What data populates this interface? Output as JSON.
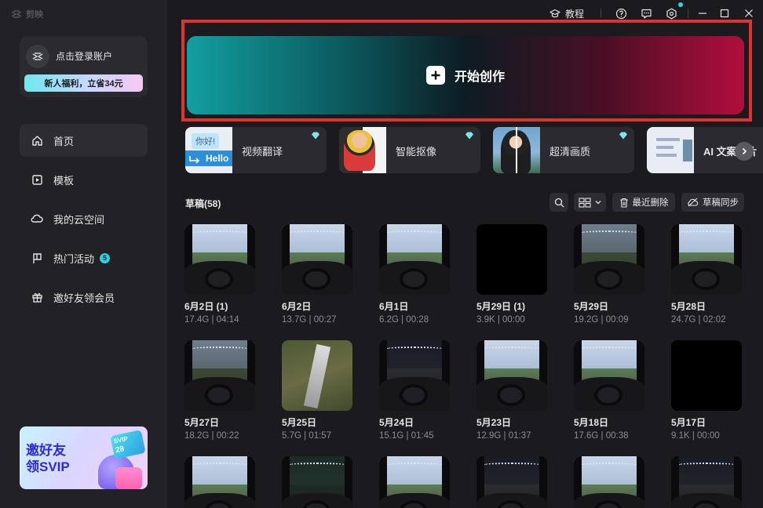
{
  "app": {
    "name": "剪映"
  },
  "titlebar": {
    "tutorial_label": "教程",
    "icons": [
      "help-icon",
      "feedback-icon",
      "settings-icon",
      "minimize-icon",
      "maximize-icon",
      "close-icon"
    ]
  },
  "account": {
    "login_label": "点击登录账户",
    "promo_label": "新人福利，立省34元"
  },
  "nav": [
    {
      "label": "首页",
      "icon": "home-icon",
      "active": true
    },
    {
      "label": "模板",
      "icon": "template-icon"
    },
    {
      "label": "我的云空间",
      "icon": "cloud-icon"
    },
    {
      "label": "热门活动",
      "icon": "flag-icon",
      "badge": "5"
    },
    {
      "label": "邀好友领会员",
      "icon": "gift-icon"
    }
  ],
  "svip_banner": {
    "text_line1": "邀好友",
    "text_line2": "领SVIP",
    "card_label": "SVIP",
    "card_value": "28"
  },
  "start": {
    "label": "开始创作"
  },
  "features": [
    {
      "label": "视频翻译",
      "thumb_text1": "你好!",
      "thumb_text2": "Hello"
    },
    {
      "label": "智能抠像"
    },
    {
      "label": "超清画质"
    },
    {
      "label": "AI 文案成片"
    }
  ],
  "drafts": {
    "title": "草稿(58)",
    "recent_delete_label": "最近删除",
    "sync_label": "草稿同步",
    "items": [
      {
        "name": "6月2日 (1)",
        "meta": "17.4G | 04:14",
        "style": "road"
      },
      {
        "name": "6月2日",
        "meta": "13.7G | 00:27",
        "style": "road"
      },
      {
        "name": "6月1日",
        "meta": "6.2G | 00:28",
        "style": "road"
      },
      {
        "name": "5月29日 (1)",
        "meta": "3.9K | 00:00",
        "style": "black"
      },
      {
        "name": "5月29日",
        "meta": "19.2G | 00:09",
        "style": "dim"
      },
      {
        "name": "5月28日",
        "meta": "24.7G | 02:02",
        "style": "road"
      },
      {
        "name": "5月27日",
        "meta": "18.2G | 00:22",
        "style": "dim"
      },
      {
        "name": "5月25日",
        "meta": "5.7G | 01:57",
        "style": "aerial"
      },
      {
        "name": "5月24日",
        "meta": "15.1G | 01:45",
        "style": "night"
      },
      {
        "name": "5月23日",
        "meta": "12.9G | 01:37",
        "style": "road"
      },
      {
        "name": "5月18日",
        "meta": "17.6G | 00:38",
        "style": "road"
      },
      {
        "name": "5月17日",
        "meta": "9.1K | 00:00",
        "style": "black"
      },
      {
        "name": "",
        "meta": "",
        "style": "road"
      },
      {
        "name": "",
        "meta": "",
        "style": "darkgreen"
      },
      {
        "name": "",
        "meta": "",
        "style": "road"
      },
      {
        "name": "",
        "meta": "",
        "style": "night"
      },
      {
        "name": "",
        "meta": "",
        "style": "road"
      },
      {
        "name": "",
        "meta": "",
        "style": "night"
      }
    ]
  },
  "colors": {
    "accent": "#2bd4e0",
    "highlight_outline": "#e0332e",
    "start_gradient_left": "#129fa0",
    "start_gradient_right": "#b20e3c"
  }
}
